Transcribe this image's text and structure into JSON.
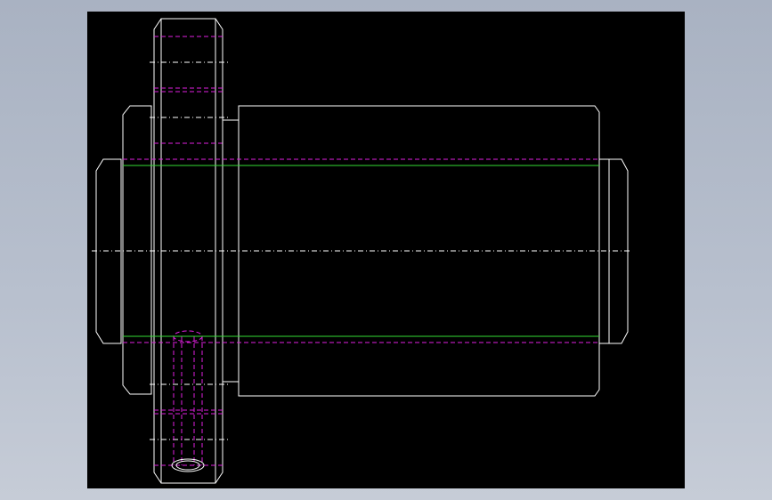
{
  "app": {
    "background_color": "#b0b9c8",
    "viewport_color": "#000000"
  },
  "drawing": {
    "type": "cad-2d-orthographic-view",
    "colors": {
      "outline": "#ffffff",
      "hidden_line": "#e020e0",
      "centerline": "#ffffff",
      "thread_line": "#33dd33"
    }
  }
}
